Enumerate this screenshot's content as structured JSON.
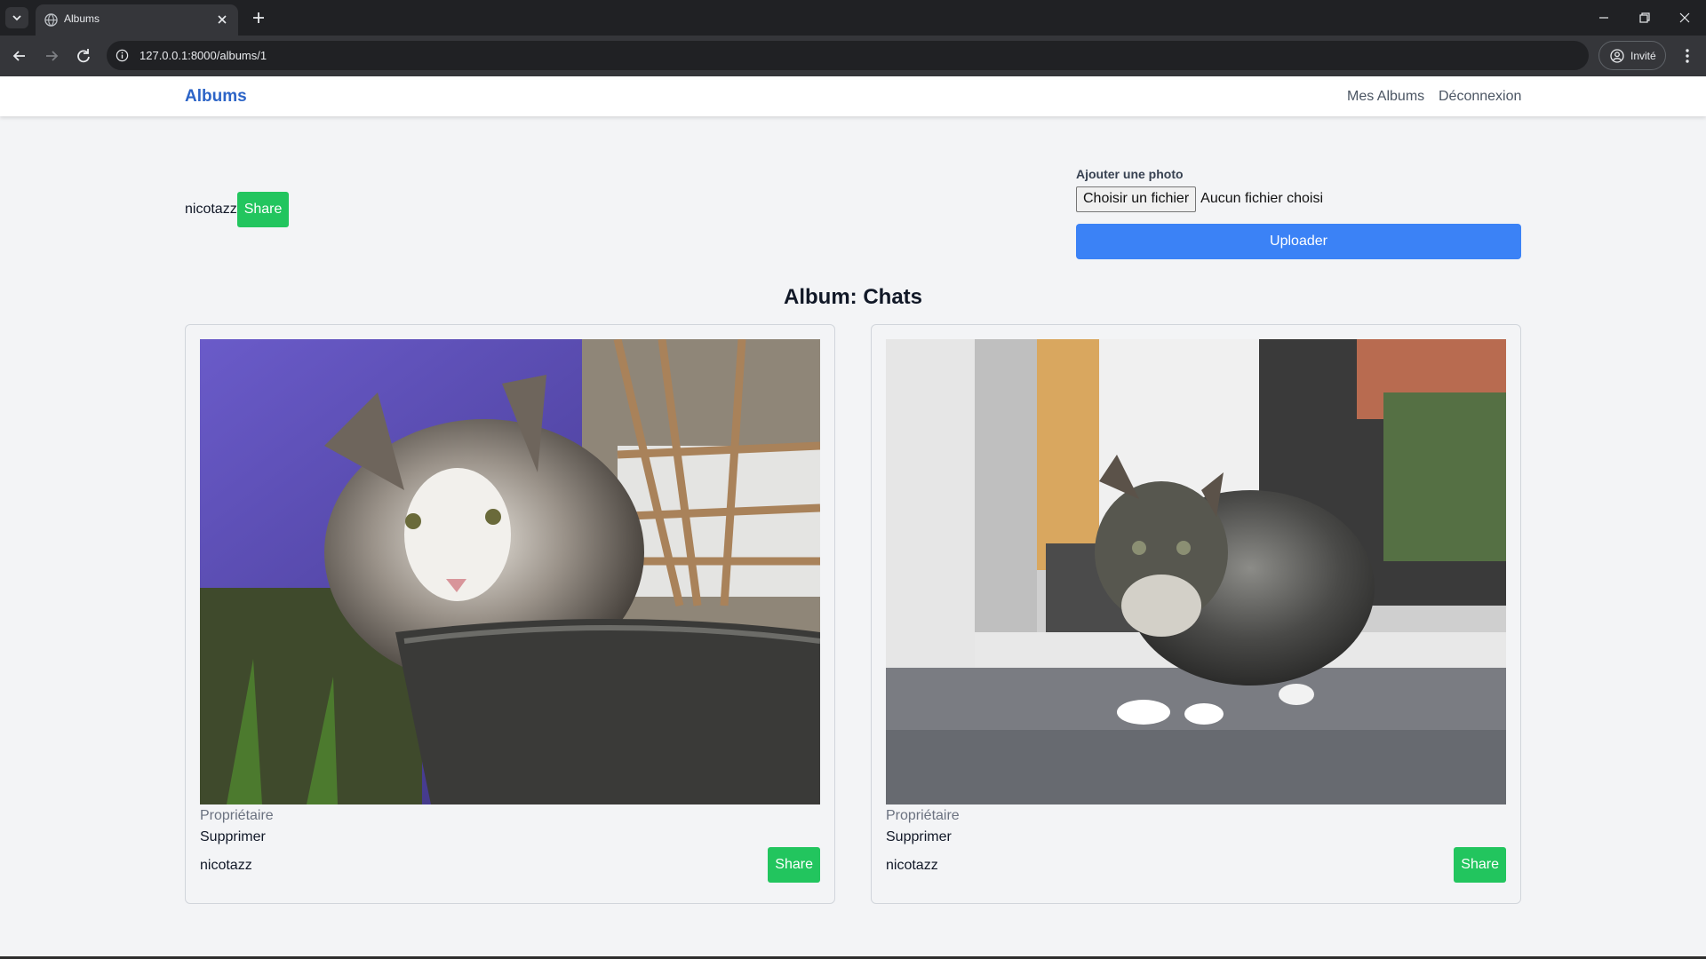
{
  "browser": {
    "tab_title": "Albums",
    "url": "127.0.0.1:8000/albums/1",
    "profile_label": "Invité"
  },
  "nav": {
    "brand": "Albums",
    "links": [
      "Mes Albums",
      "Déconnexion"
    ]
  },
  "album_owner": {
    "name": "nicotazz",
    "share_label": "Share"
  },
  "upload": {
    "label": "Ajouter une photo",
    "choose_file_label": "Choisir un fichier",
    "no_file_text": "Aucun fichier choisi",
    "submit_label": "Uploader"
  },
  "album": {
    "title": "Album: Chats"
  },
  "photos": [
    {
      "owner_label": "Propriétaire",
      "delete_label": "Supprimer",
      "username": "nicotazz",
      "share_label": "Share"
    },
    {
      "owner_label": "Propriétaire",
      "delete_label": "Supprimer",
      "username": "nicotazz",
      "share_label": "Share"
    }
  ],
  "colors": {
    "brand": "#2c64c7",
    "share_green": "#22c55e",
    "upload_blue": "#3b82f6",
    "page_bg": "#f3f4f6"
  }
}
